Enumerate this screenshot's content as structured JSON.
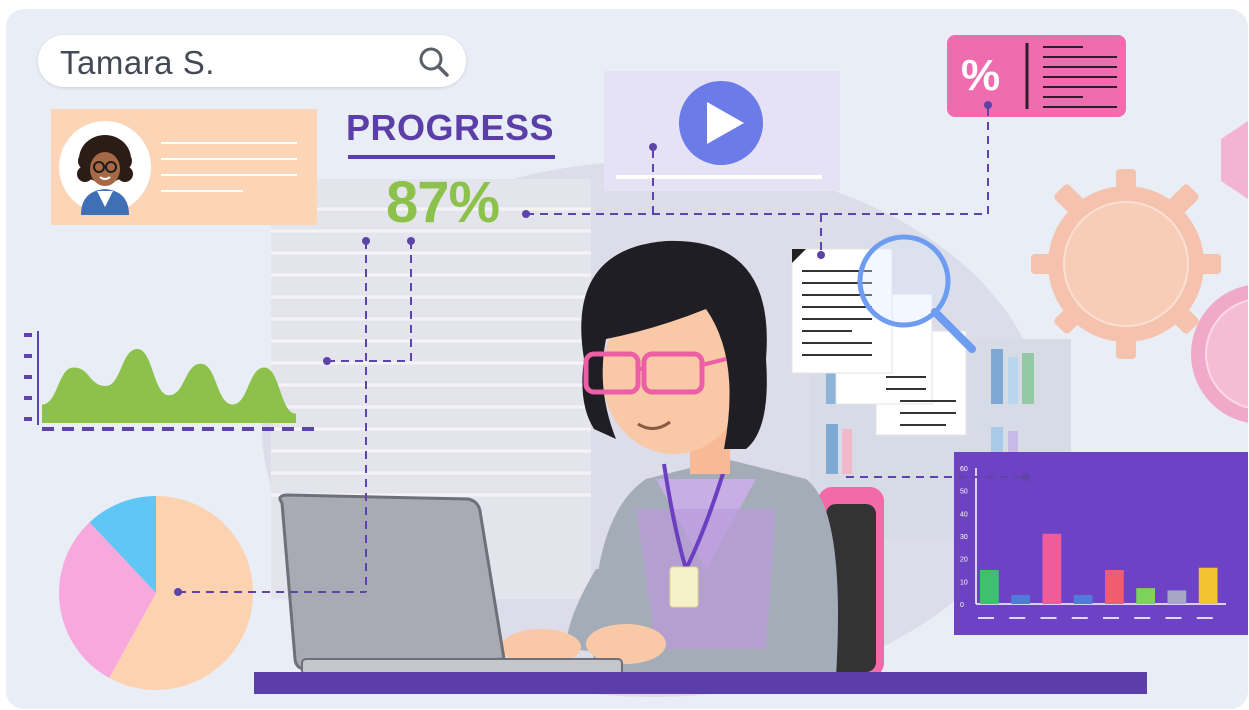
{
  "search": {
    "value": "Tamara S.",
    "icon": "search-icon"
  },
  "progress": {
    "title": "PROGRESS",
    "value": "87%",
    "percent": 87
  },
  "coupon": {
    "symbol": "%"
  },
  "video": {
    "icon": "play-icon"
  },
  "colors": {
    "background": "#e8edf6",
    "accent_purple": "#5b3ea8",
    "progress_green": "#8cc24b",
    "profile_card": "#fcd4b6",
    "coupon_pink": "#ef6dae",
    "play_blue": "#6b7be8",
    "bar_panel": "#6d42c4"
  },
  "chart_data": [
    {
      "type": "area",
      "x": [
        0,
        1,
        2,
        3,
        4,
        5,
        6,
        7,
        8
      ],
      "values": [
        1,
        3,
        2,
        4,
        1.5,
        3.2,
        1,
        3,
        0.5
      ]
    },
    {
      "type": "pie",
      "values": [
        58,
        30,
        12
      ],
      "colors": [
        "#fdd2b0",
        "#f7a8dc",
        "#60c6f5"
      ]
    },
    {
      "type": "bar",
      "categories": [
        "",
        "",
        "",
        "",
        "",
        "",
        "",
        ""
      ],
      "values": [
        15,
        4,
        31,
        4,
        15,
        7,
        6,
        16
      ],
      "colors": [
        "#3ec16e",
        "#4f7bdc",
        "#f05c9a",
        "#4f7bdc",
        "#f25c72",
        "#7dd35a",
        "#a6a6c8",
        "#f2c430"
      ],
      "ylim": [
        0,
        60
      ],
      "yticks": [
        "0",
        "10",
        "20",
        "30",
        "40",
        "50",
        "60"
      ]
    }
  ]
}
